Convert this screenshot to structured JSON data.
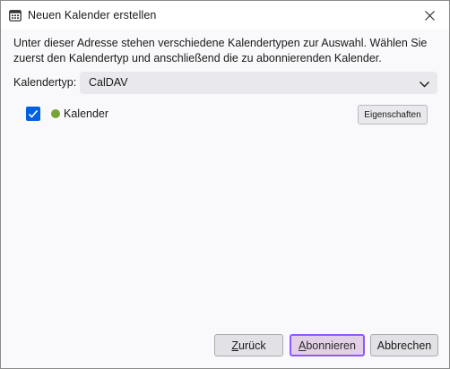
{
  "window": {
    "title": "Neuen Kalender erstellen",
    "icon": "calendar-icon",
    "close_icon": "close-icon"
  },
  "dialog": {
    "description": "Unter dieser Adresse stehen verschiedene Kalendertypen zur Auswahl. Wählen Sie zuerst den Kalendertyp und anschließend die zu abonnierenden Kalender.",
    "type_label": "Kalendertyp:",
    "type_value": "CalDAV",
    "calendars": [
      {
        "name": "Kalender",
        "checked": true,
        "color": "#78a436",
        "properties_label": "Eigenschaften"
      }
    ]
  },
  "footer": {
    "back_mnemonic": "Z",
    "back_rest": "urück",
    "subscribe_mnemonic": "A",
    "subscribe_rest": "bonnieren",
    "cancel_label": "Abbrechen"
  },
  "colors": {
    "accent": "#0061e0",
    "focus": "#9059ff",
    "calendar_dot": "#78a436"
  }
}
